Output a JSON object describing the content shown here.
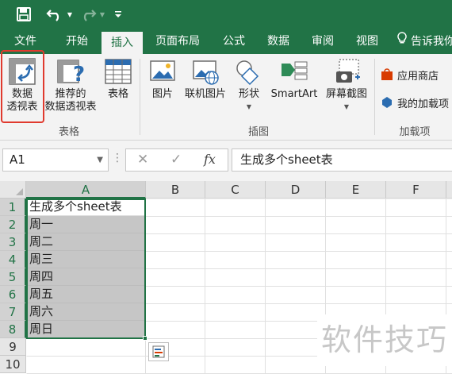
{
  "qat": {
    "icons": [
      "save-icon",
      "undo-icon",
      "redo-icon",
      "customize-qat-icon"
    ]
  },
  "tabs": [
    {
      "label": "文件"
    },
    {
      "label": "开始"
    },
    {
      "label": "插入",
      "active": true
    },
    {
      "label": "页面布局"
    },
    {
      "label": "公式"
    },
    {
      "label": "数据"
    },
    {
      "label": "审阅"
    },
    {
      "label": "视图"
    },
    {
      "label": "告诉我你"
    }
  ],
  "ribbon": {
    "pivot_table": {
      "line1": "数据",
      "line2": "透视表"
    },
    "recommended_pivot": {
      "line1": "推荐的",
      "line2": "数据透视表"
    },
    "table": {
      "label": "表格"
    },
    "group_tables": "表格",
    "picture": {
      "label": "图片"
    },
    "online_picture": {
      "label": "联机图片"
    },
    "shapes": {
      "label": "形状"
    },
    "smartart": {
      "label": "SmartArt"
    },
    "screenshot": {
      "label": "屏幕截图"
    },
    "group_illustrations": "插图",
    "store": {
      "label": "应用商店"
    },
    "my_addins": {
      "label": "我的加载项"
    },
    "group_addins": "加载项"
  },
  "formula_bar": {
    "name_box": "A1",
    "fx": "fx",
    "formula": "生成多个sheet表"
  },
  "grid": {
    "columns": [
      "A",
      "B",
      "C",
      "D",
      "E",
      "F"
    ],
    "rows": [
      "1",
      "2",
      "3",
      "4",
      "5",
      "6",
      "7",
      "8",
      "9",
      "10"
    ],
    "column_a_values": [
      "生成多个sheet表",
      "周一",
      "周二",
      "周三",
      "周四",
      "周五",
      "周六",
      "周日"
    ]
  },
  "watermark": "软件技巧",
  "colors": {
    "accent": "#217346",
    "highlight_box": "#e03a2e",
    "selection_fill": "#c6c6c6"
  }
}
